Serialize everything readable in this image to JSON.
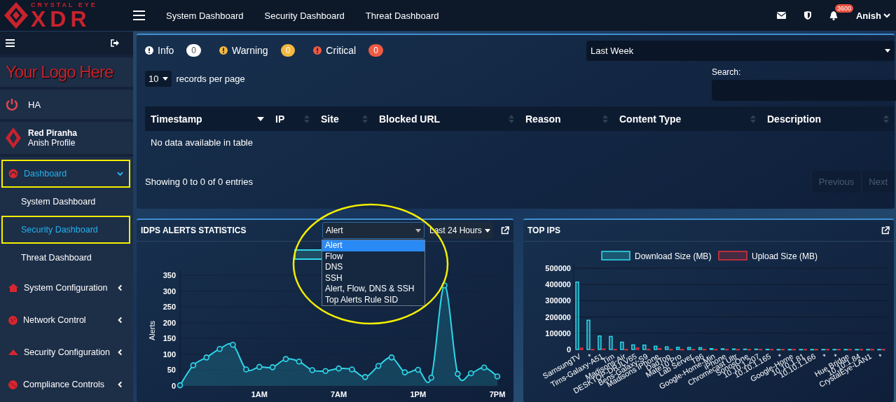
{
  "header": {
    "brand_top": "CRYSTAL EYE",
    "brand_main": "XDR",
    "nav": [
      "System Dashboard",
      "Security Dashboard",
      "Threat Dashboard"
    ],
    "notification_count": "3600",
    "user": "Anish"
  },
  "sidebar": {
    "logo_text": "Your Logo Here",
    "ha_label": "HA",
    "profile": {
      "org": "Red Piranha",
      "name": "Anish Profile"
    },
    "items": [
      {
        "label": "Dashboard",
        "selected": true,
        "highlighted": true,
        "expanded": true,
        "children": [
          {
            "label": "System Dashboard",
            "selected": false,
            "highlighted": false
          },
          {
            "label": "Security Dashboard",
            "selected": true,
            "highlighted": true
          },
          {
            "label": "Threat Dashboard",
            "selected": false,
            "highlighted": false
          }
        ]
      },
      {
        "label": "System Configuration",
        "selected": false,
        "highlighted": false,
        "expanded": false
      },
      {
        "label": "Network Control",
        "selected": false,
        "highlighted": false,
        "expanded": false
      },
      {
        "label": "Security Configuration",
        "selected": false,
        "highlighted": false,
        "expanded": false
      },
      {
        "label": "Compliance Controls",
        "selected": false,
        "highlighted": false,
        "expanded": false
      }
    ]
  },
  "scan_summary": {
    "severities": [
      {
        "label": "Info",
        "count": "0",
        "color": "#ffffff"
      },
      {
        "label": "Warning",
        "count": "0",
        "color": "#f4b73f"
      },
      {
        "label": "Critical",
        "count": "0",
        "color": "#ef5a43"
      }
    ],
    "period": "Last Week",
    "page_size": "10",
    "page_size_label": "records per page",
    "search_label": "Search:",
    "columns": [
      {
        "label": "Timestamp",
        "sorted": true
      },
      {
        "label": "IP",
        "sorted": false
      },
      {
        "label": "Site",
        "sorted": false
      },
      {
        "label": "Blocked URL",
        "sorted": false
      },
      {
        "label": "Reason",
        "sorted": false
      },
      {
        "label": "Content Type",
        "sorted": false
      },
      {
        "label": "Description",
        "sorted": false
      }
    ],
    "empty_message": "No data available in table",
    "info": "Showing 0 to 0 of 0 entries",
    "pagination": [
      {
        "label": "Previous",
        "disabled": true
      },
      {
        "label": "Next",
        "disabled": true
      }
    ]
  },
  "idps": {
    "title": "IDPS ALERTS STATISTICS",
    "type_select": {
      "value": "Alert",
      "expanded": true,
      "highlighted": true,
      "options": [
        {
          "label": "Alert",
          "selected": true
        },
        {
          "label": "Flow",
          "selected": false
        },
        {
          "label": "DNS",
          "selected": false
        },
        {
          "label": "SSH",
          "selected": false
        },
        {
          "label": "Alert, Flow, DNS & SSH",
          "selected": false
        },
        {
          "label": "Top Alerts Rule SID",
          "selected": false
        }
      ]
    },
    "range_select": "Last 24 Hours",
    "chart_data": {
      "type": "area",
      "ylabel": "Alerts",
      "grid": true,
      "categories": [
        null,
        null,
        null,
        null,
        null,
        null,
        "1AM",
        null,
        null,
        null,
        null,
        null,
        "7AM",
        null,
        null,
        null,
        null,
        null,
        "1PM",
        null,
        null,
        null,
        null,
        null,
        "7PM"
      ],
      "series": [
        {
          "color": "#2fd6e8",
          "values": [
            2,
            65,
            90,
            117,
            130,
            52,
            60,
            59,
            85,
            77,
            50,
            47,
            55,
            52,
            28,
            63,
            90,
            43,
            51,
            26,
            318,
            38,
            40,
            58,
            30
          ]
        }
      ],
      "ylim": [
        0,
        350
      ],
      "yticks": [
        0,
        50,
        100,
        150,
        200,
        250,
        300,
        350
      ]
    }
  },
  "top_ips": {
    "title": "TOP IPS",
    "chart_data": {
      "type": "bar",
      "grid": true,
      "legend": true,
      "categories": [
        "SamsungTV",
        "*",
        "Tims-Galaxy-A51",
        "Tim",
        "Madisons-Air",
        "DESKTOP-DRJLV65",
        "Bens-Galaxy-S9",
        "Madisons iPhone",
        "DadTop",
        "Mate10 Pro",
        "Lab Server",
        "T86",
        "Google-Home-Min",
        "iPhone",
        "Chromecast Ultr",
        "SonosOne",
        "10.10.1.207",
        "10.10.1.165",
        "*",
        "Google-Home",
        "10.10.1.81",
        "10.10.1.166",
        "*",
        "*",
        "Hue Bridge",
        "10.10.1.84",
        "CrystalEye-LAN1",
        "*"
      ],
      "series": [
        {
          "name": "Download Size (MB)",
          "color": "#2fd6e8",
          "values": [
            415000,
            180000,
            83000,
            80000,
            45000,
            28000,
            27000,
            20000,
            16000,
            13000,
            12000,
            11000,
            5000,
            4000,
            3000,
            2000,
            2000,
            1000,
            0,
            0,
            0,
            0,
            0,
            0,
            0,
            0,
            0,
            0
          ]
        },
        {
          "name": "Upload Size (MB)",
          "color": "#d9303a",
          "values": [
            8000,
            0,
            3000,
            0,
            0,
            9000,
            0,
            5000,
            0,
            0,
            0,
            0,
            0,
            0,
            0,
            0,
            0,
            0,
            0,
            0,
            0,
            0,
            0,
            0,
            0,
            0,
            0,
            0
          ]
        }
      ],
      "ylim": [
        0,
        500000
      ],
      "yticks": [
        0,
        100000,
        200000,
        300000,
        400000,
        500000
      ]
    }
  }
}
